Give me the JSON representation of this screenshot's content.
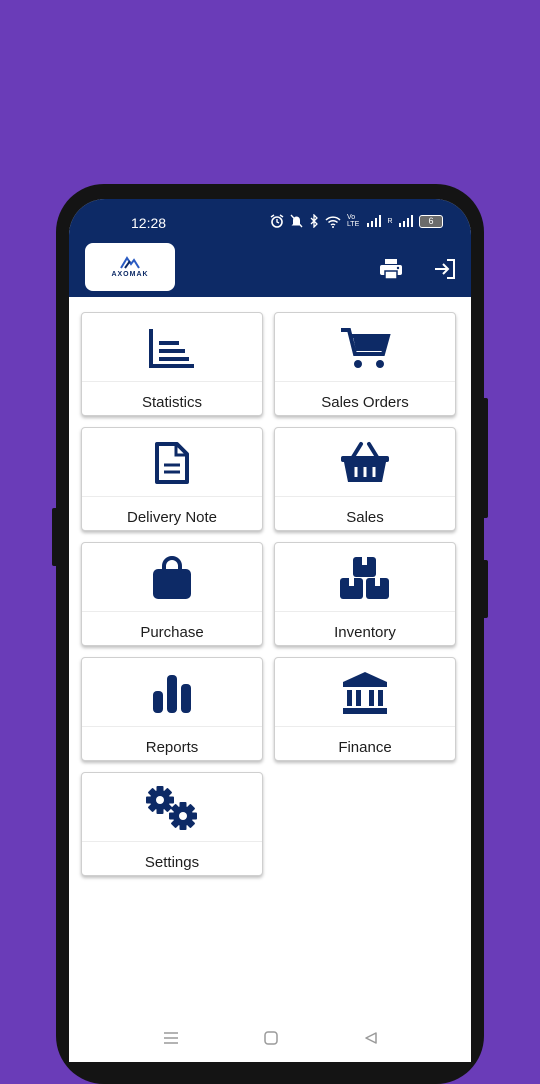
{
  "status_bar": {
    "time": "12:28",
    "carrier1": "Vo LTE",
    "carrier2": "R",
    "battery": "6"
  },
  "header": {
    "logo_text": "AXOMAK",
    "print_icon": "printer-icon",
    "logout_icon": "logout-icon"
  },
  "menu": {
    "items": [
      {
        "label": "Statistics",
        "icon": "chart-icon"
      },
      {
        "label": "Sales Orders",
        "icon": "cart-icon"
      },
      {
        "label": "Delivery Note",
        "icon": "document-icon"
      },
      {
        "label": "Sales",
        "icon": "basket-icon"
      },
      {
        "label": "Purchase",
        "icon": "shopping-bag-icon"
      },
      {
        "label": "Inventory",
        "icon": "boxes-icon"
      },
      {
        "label": "Reports",
        "icon": "bar-chart-icon"
      },
      {
        "label": "Finance",
        "icon": "bank-icon"
      },
      {
        "label": "Settings",
        "icon": "gears-icon"
      }
    ]
  },
  "colors": {
    "background": "#6a3cb8",
    "app_bar": "#0d2a66",
    "icon": "#0d2a66"
  }
}
